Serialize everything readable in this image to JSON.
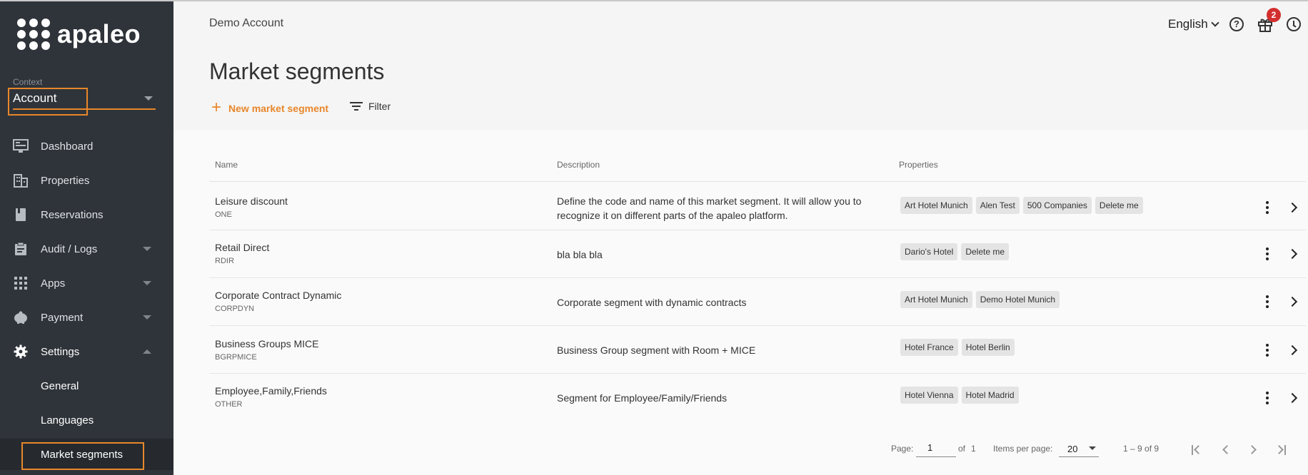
{
  "sidebar": {
    "logo_text": "apaleo",
    "context_label": "Context",
    "context_value": "Account",
    "items": [
      {
        "label": "Dashboard"
      },
      {
        "label": "Properties"
      },
      {
        "label": "Reservations"
      },
      {
        "label": "Audit / Logs"
      },
      {
        "label": "Apps"
      },
      {
        "label": "Payment"
      },
      {
        "label": "Settings"
      }
    ],
    "settings_sub": [
      {
        "label": "General"
      },
      {
        "label": "Languages"
      },
      {
        "label": "Market segments"
      }
    ]
  },
  "header": {
    "account": "Demo Account",
    "language": "English",
    "gift_badge": "2",
    "help_glyph": "?"
  },
  "page": {
    "title": "Market segments",
    "new_button": "New market segment",
    "filter_button": "Filter"
  },
  "table": {
    "columns": [
      "Name",
      "Description",
      "Properties"
    ],
    "rows": [
      {
        "name": "Leisure discount",
        "code": "ONE",
        "description": "Define the code and name of this market segment. It will allow you to recognize it on different parts of the apaleo platform.",
        "properties": [
          "Art Hotel Munich",
          "Alen Test",
          "500 Companies",
          "Delete me"
        ]
      },
      {
        "name": "Retail Direct",
        "code": "RDIR",
        "description": "bla bla bla",
        "properties": [
          "Dario's Hotel",
          "Delete me"
        ]
      },
      {
        "name": "Corporate Contract Dynamic",
        "code": "CORPDYN",
        "description": "Corporate segment with dynamic contracts",
        "properties": [
          "Art Hotel Munich",
          "Demo Hotel Munich"
        ]
      },
      {
        "name": "Business Groups MICE",
        "code": "BGRPMICE",
        "description": "Business Group segment with Room + MICE",
        "properties": [
          "Hotel France",
          "Hotel Berlin"
        ]
      },
      {
        "name": "Employee,Family,Friends",
        "code": "OTHER",
        "description": "Segment for Employee/Family/Friends",
        "properties": [
          "Hotel Vienna",
          "Hotel Madrid"
        ]
      }
    ]
  },
  "pagination": {
    "page_label": "Page:",
    "page_value": "1",
    "of_label": "of",
    "total_pages": "1",
    "items_label": "Items per page:",
    "items_value": "20",
    "range": "1 – 9 of 9"
  },
  "colors": {
    "accent": "#e8872b",
    "sidebar_bg": "#2f343a",
    "badge": "#d32f2f"
  }
}
